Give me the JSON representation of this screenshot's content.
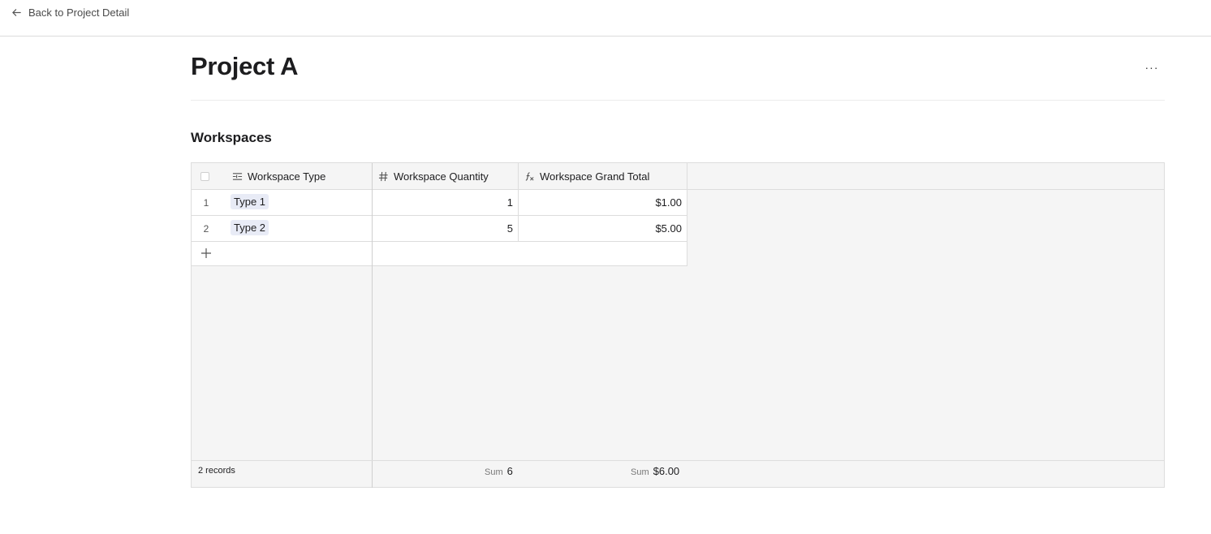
{
  "nav": {
    "back_label": "Back to Project Detail"
  },
  "page": {
    "title": "Project A",
    "more_label": "···"
  },
  "section": {
    "title": "Workspaces"
  },
  "table": {
    "columns": [
      {
        "label": "Workspace Type",
        "icon": "text-lines-icon"
      },
      {
        "label": "Workspace Quantity",
        "icon": "hash-icon"
      },
      {
        "label": "Workspace Grand Total",
        "icon": "formula-icon"
      }
    ],
    "rows": [
      {
        "num": "1",
        "type": "Type 1",
        "quantity": "1",
        "total": "$1.00"
      },
      {
        "num": "2",
        "type": "Type 2",
        "quantity": "5",
        "total": "$5.00"
      }
    ],
    "footer": {
      "records": "2 records",
      "sum_label": "Sum",
      "quantity_sum": "6",
      "total_sum": "$6.00"
    }
  }
}
